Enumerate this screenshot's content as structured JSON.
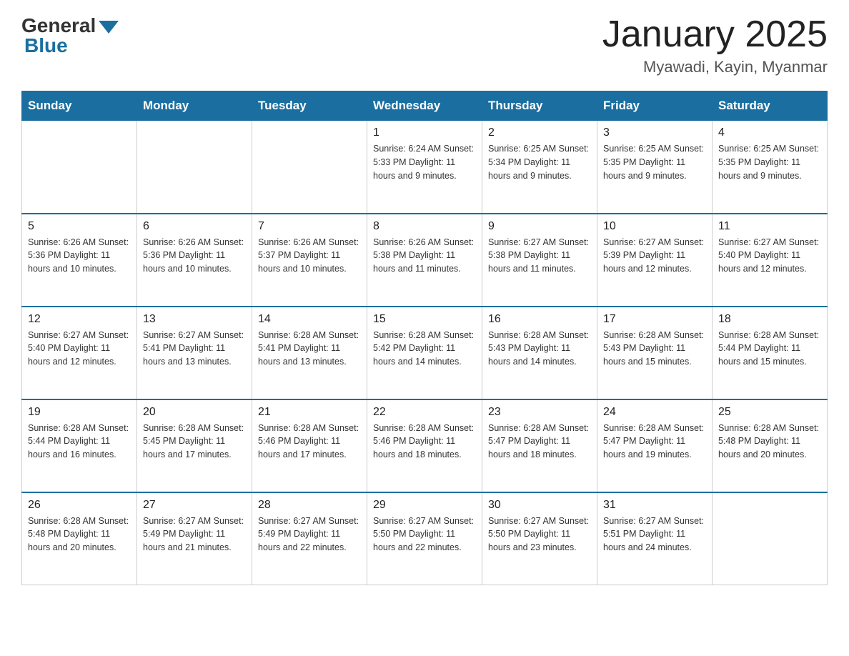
{
  "header": {
    "logo_general": "General",
    "logo_blue": "Blue",
    "month_title": "January 2025",
    "location": "Myawadi, Kayin, Myanmar"
  },
  "days_of_week": [
    "Sunday",
    "Monday",
    "Tuesday",
    "Wednesday",
    "Thursday",
    "Friday",
    "Saturday"
  ],
  "weeks": [
    {
      "days": [
        {
          "number": "",
          "info": ""
        },
        {
          "number": "",
          "info": ""
        },
        {
          "number": "",
          "info": ""
        },
        {
          "number": "1",
          "info": "Sunrise: 6:24 AM\nSunset: 5:33 PM\nDaylight: 11 hours and 9 minutes."
        },
        {
          "number": "2",
          "info": "Sunrise: 6:25 AM\nSunset: 5:34 PM\nDaylight: 11 hours and 9 minutes."
        },
        {
          "number": "3",
          "info": "Sunrise: 6:25 AM\nSunset: 5:35 PM\nDaylight: 11 hours and 9 minutes."
        },
        {
          "number": "4",
          "info": "Sunrise: 6:25 AM\nSunset: 5:35 PM\nDaylight: 11 hours and 9 minutes."
        }
      ]
    },
    {
      "days": [
        {
          "number": "5",
          "info": "Sunrise: 6:26 AM\nSunset: 5:36 PM\nDaylight: 11 hours and 10 minutes."
        },
        {
          "number": "6",
          "info": "Sunrise: 6:26 AM\nSunset: 5:36 PM\nDaylight: 11 hours and 10 minutes."
        },
        {
          "number": "7",
          "info": "Sunrise: 6:26 AM\nSunset: 5:37 PM\nDaylight: 11 hours and 10 minutes."
        },
        {
          "number": "8",
          "info": "Sunrise: 6:26 AM\nSunset: 5:38 PM\nDaylight: 11 hours and 11 minutes."
        },
        {
          "number": "9",
          "info": "Sunrise: 6:27 AM\nSunset: 5:38 PM\nDaylight: 11 hours and 11 minutes."
        },
        {
          "number": "10",
          "info": "Sunrise: 6:27 AM\nSunset: 5:39 PM\nDaylight: 11 hours and 12 minutes."
        },
        {
          "number": "11",
          "info": "Sunrise: 6:27 AM\nSunset: 5:40 PM\nDaylight: 11 hours and 12 minutes."
        }
      ]
    },
    {
      "days": [
        {
          "number": "12",
          "info": "Sunrise: 6:27 AM\nSunset: 5:40 PM\nDaylight: 11 hours and 12 minutes."
        },
        {
          "number": "13",
          "info": "Sunrise: 6:27 AM\nSunset: 5:41 PM\nDaylight: 11 hours and 13 minutes."
        },
        {
          "number": "14",
          "info": "Sunrise: 6:28 AM\nSunset: 5:41 PM\nDaylight: 11 hours and 13 minutes."
        },
        {
          "number": "15",
          "info": "Sunrise: 6:28 AM\nSunset: 5:42 PM\nDaylight: 11 hours and 14 minutes."
        },
        {
          "number": "16",
          "info": "Sunrise: 6:28 AM\nSunset: 5:43 PM\nDaylight: 11 hours and 14 minutes."
        },
        {
          "number": "17",
          "info": "Sunrise: 6:28 AM\nSunset: 5:43 PM\nDaylight: 11 hours and 15 minutes."
        },
        {
          "number": "18",
          "info": "Sunrise: 6:28 AM\nSunset: 5:44 PM\nDaylight: 11 hours and 15 minutes."
        }
      ]
    },
    {
      "days": [
        {
          "number": "19",
          "info": "Sunrise: 6:28 AM\nSunset: 5:44 PM\nDaylight: 11 hours and 16 minutes."
        },
        {
          "number": "20",
          "info": "Sunrise: 6:28 AM\nSunset: 5:45 PM\nDaylight: 11 hours and 17 minutes."
        },
        {
          "number": "21",
          "info": "Sunrise: 6:28 AM\nSunset: 5:46 PM\nDaylight: 11 hours and 17 minutes."
        },
        {
          "number": "22",
          "info": "Sunrise: 6:28 AM\nSunset: 5:46 PM\nDaylight: 11 hours and 18 minutes."
        },
        {
          "number": "23",
          "info": "Sunrise: 6:28 AM\nSunset: 5:47 PM\nDaylight: 11 hours and 18 minutes."
        },
        {
          "number": "24",
          "info": "Sunrise: 6:28 AM\nSunset: 5:47 PM\nDaylight: 11 hours and 19 minutes."
        },
        {
          "number": "25",
          "info": "Sunrise: 6:28 AM\nSunset: 5:48 PM\nDaylight: 11 hours and 20 minutes."
        }
      ]
    },
    {
      "days": [
        {
          "number": "26",
          "info": "Sunrise: 6:28 AM\nSunset: 5:48 PM\nDaylight: 11 hours and 20 minutes."
        },
        {
          "number": "27",
          "info": "Sunrise: 6:27 AM\nSunset: 5:49 PM\nDaylight: 11 hours and 21 minutes."
        },
        {
          "number": "28",
          "info": "Sunrise: 6:27 AM\nSunset: 5:49 PM\nDaylight: 11 hours and 22 minutes."
        },
        {
          "number": "29",
          "info": "Sunrise: 6:27 AM\nSunset: 5:50 PM\nDaylight: 11 hours and 22 minutes."
        },
        {
          "number": "30",
          "info": "Sunrise: 6:27 AM\nSunset: 5:50 PM\nDaylight: 11 hours and 23 minutes."
        },
        {
          "number": "31",
          "info": "Sunrise: 6:27 AM\nSunset: 5:51 PM\nDaylight: 11 hours and 24 minutes."
        },
        {
          "number": "",
          "info": ""
        }
      ]
    }
  ]
}
